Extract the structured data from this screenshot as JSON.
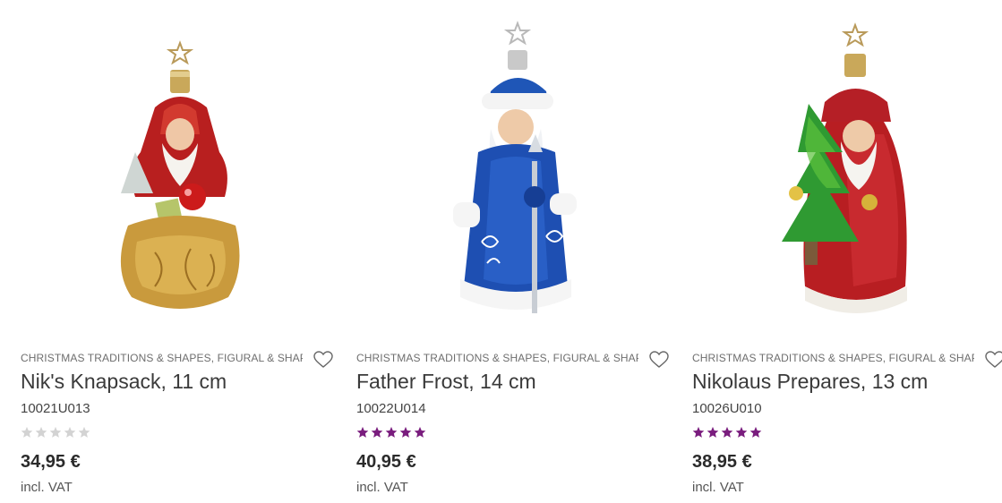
{
  "colors": {
    "rating_filled": "#7a1d7e",
    "rating_empty": "#d3d3d3"
  },
  "products": [
    {
      "category": "CHRISTMAS TRADITIONS & SHAPES, FIGURAL & SHAPES,...",
      "title": "Nik's Knapsack, 11 cm",
      "sku": "10021U013",
      "rating": 0,
      "rating_max": 5,
      "price": "34,95 €",
      "vat": "incl. VAT",
      "image_icon": "santa-knapsack-ornament-image",
      "wishlist_icon": "heart-icon"
    },
    {
      "category": "CHRISTMAS TRADITIONS & SHAPES, FIGURAL & SHAPES,...",
      "title": "Father Frost, 14 cm",
      "sku": "10022U014",
      "rating": 5,
      "rating_max": 5,
      "price": "40,95 €",
      "vat": "incl. VAT",
      "image_icon": "father-frost-ornament-image",
      "wishlist_icon": "heart-icon"
    },
    {
      "category": "CHRISTMAS TRADITIONS & SHAPES, FIGURAL & SHAPES,...",
      "title": "Nikolaus Prepares, 13 cm",
      "sku": "10026U010",
      "rating": 5,
      "rating_max": 5,
      "price": "38,95 €",
      "vat": "incl. VAT",
      "image_icon": "nikolaus-tree-ornament-image",
      "wishlist_icon": "heart-icon"
    }
  ]
}
